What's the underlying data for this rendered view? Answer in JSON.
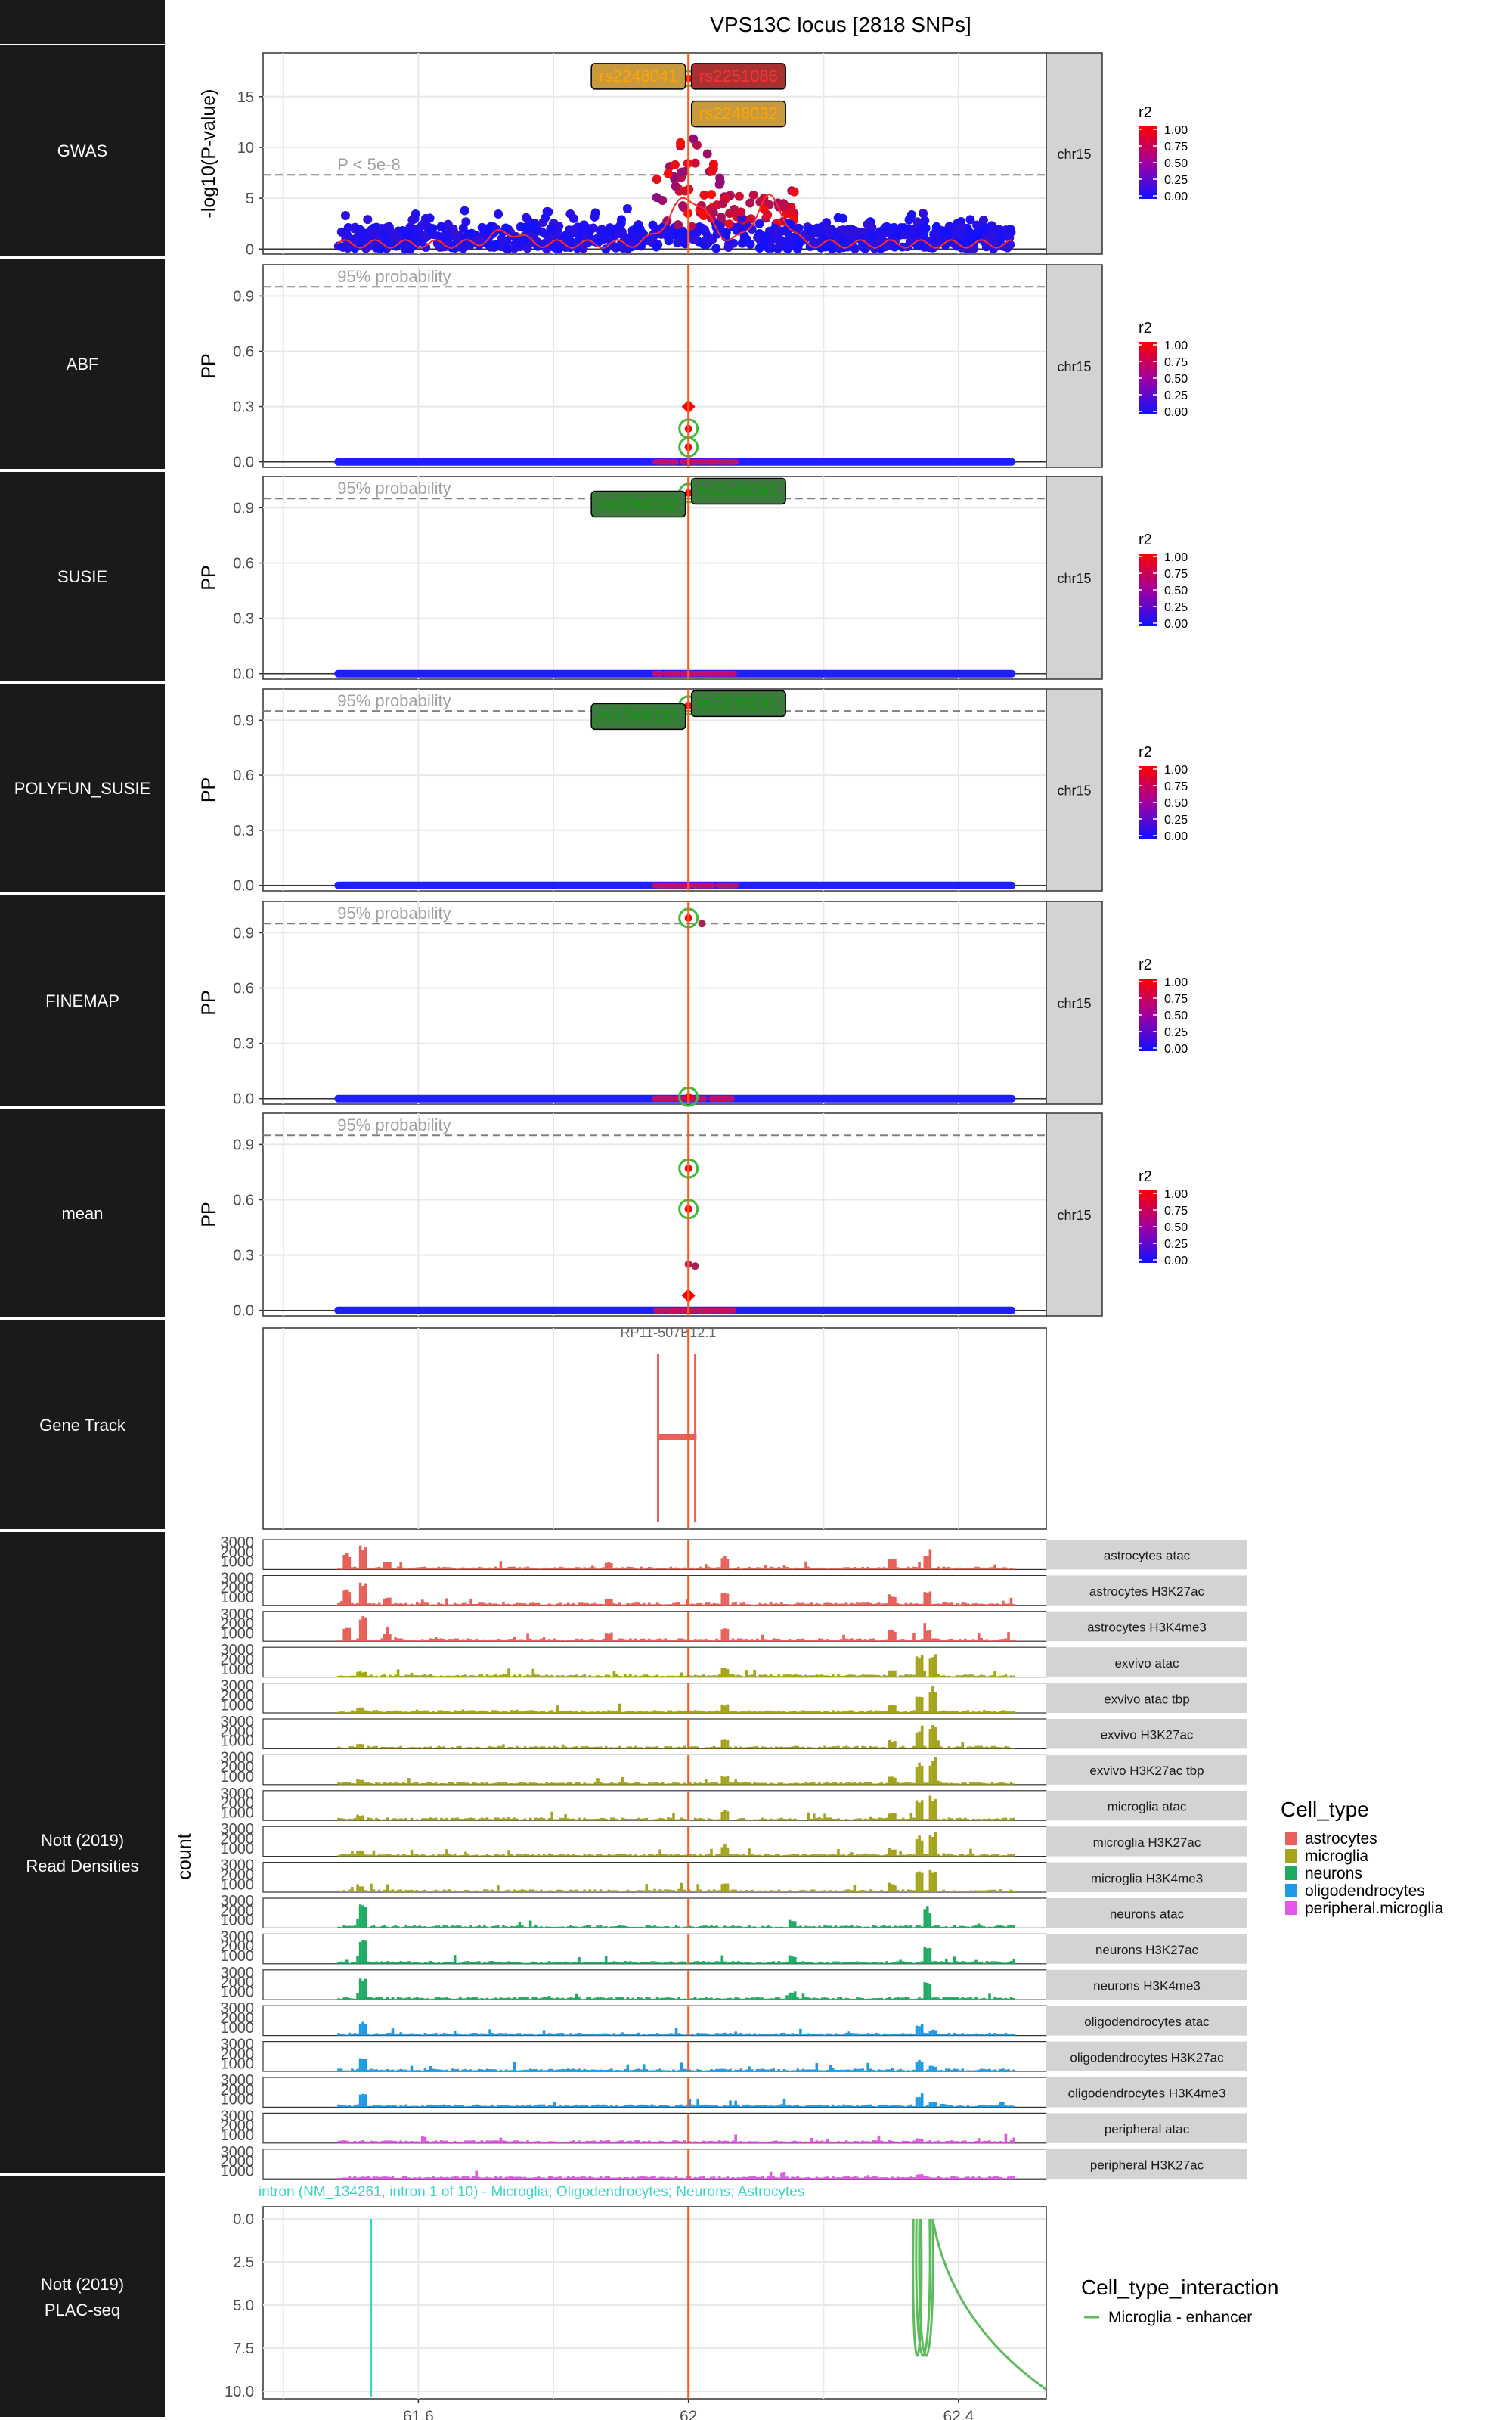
{
  "figure": {
    "title": "VPS13C locus [2818 SNPs]",
    "lead_line_x": 62.0,
    "x_axis": {
      "ticks": [
        61.6,
        62,
        62.4
      ],
      "tick_labels": [
        "61.6",
        "62",
        "62.4"
      ],
      "range": [
        61.37,
        62.53
      ]
    },
    "colors": {
      "lead_line": "#ff5a1f",
      "snp_low": "#1010ff",
      "snp_high": "#ff0000",
      "lead_ring": "#3dbb3d",
      "strip_bg": "#d3d3d3",
      "left_strip_bg": "#1a1a1a",
      "gwas_curve": "#ff2a2a",
      "threshold_line": "#808080"
    }
  },
  "row_labels": [
    "GWAS",
    "ABF",
    "SUSIE",
    "POLYFUN_SUSIE",
    "FINEMAP",
    "mean",
    "Gene Track",
    "Nott (2019)\nRead Densities",
    "Nott (2019)\nPLAC-seq"
  ],
  "facet_strip": "chr15",
  "color_legend": {
    "title": "r2",
    "labels": [
      "1.00",
      "0.75",
      "0.50",
      "0.25",
      "0.00"
    ]
  },
  "gwas": {
    "ylabel": "-log10(P-value)",
    "yticks": [
      0,
      5,
      10,
      15
    ],
    "ylim": [
      -0.5,
      19.3
    ],
    "threshold": 7.3,
    "threshold_label": "P < 5e-8",
    "snp_labels": [
      {
        "text": "rs2248041",
        "x": 62.0,
        "y": 17.0,
        "side": "left",
        "fill": "#c89a40",
        "color": "#ffa500"
      },
      {
        "text": "rs2251086",
        "x": 62.0,
        "y": 17.0,
        "side": "right",
        "fill": "#a83232",
        "color": "#ff3030"
      },
      {
        "text": "rs2248032",
        "x": 62.0,
        "y": 13.3,
        "side": "right",
        "fill": "#c89a40",
        "color": "#ffa500"
      }
    ]
  },
  "pp_panels": [
    {
      "name": "ABF",
      "ylabel": "PP",
      "threshold_label": "95% probability",
      "labels": []
    },
    {
      "name": "SUSIE",
      "ylabel": "PP",
      "threshold_label": "95% probability",
      "labels": [
        {
          "text": "rs2248041",
          "y": 0.99,
          "side": "right"
        },
        {
          "text": "rs2248032",
          "y": 0.92,
          "side": "left"
        }
      ]
    },
    {
      "name": "POLYFUN_SUSIE",
      "ylabel": "PP",
      "threshold_label": "95% probability",
      "labels": [
        {
          "text": "rs2248041",
          "y": 0.99,
          "side": "right"
        },
        {
          "text": "rs2248032",
          "y": 0.92,
          "side": "left"
        }
      ]
    },
    {
      "name": "FINEMAP",
      "ylabel": "PP",
      "threshold_label": "95% probability",
      "labels": []
    },
    {
      "name": "mean",
      "ylabel": "PP",
      "threshold_label": "95% probability",
      "labels": []
    }
  ],
  "pp_axis": {
    "yticks": [
      0.0,
      0.3,
      0.6,
      0.9
    ],
    "ytick_labels": [
      "0.0",
      "0.3",
      "0.6",
      "0.9"
    ],
    "ylim": [
      -0.03,
      1.07
    ],
    "threshold": 0.95
  },
  "gene_track": {
    "gene_label": "RP11-507B12.1"
  },
  "read_densities": {
    "ylabel": "count",
    "yticks": [
      "3000",
      "2000",
      "1000"
    ],
    "tracks": [
      {
        "label": "astrocytes atac",
        "cell": "astrocytes"
      },
      {
        "label": "astrocytes H3K27ac",
        "cell": "astrocytes"
      },
      {
        "label": "astrocytes H3K4me3",
        "cell": "astrocytes"
      },
      {
        "label": "exvivo atac",
        "cell": "microglia"
      },
      {
        "label": "exvivo atac tbp",
        "cell": "microglia"
      },
      {
        "label": "exvivo H3K27ac",
        "cell": "microglia"
      },
      {
        "label": "exvivo H3K27ac tbp",
        "cell": "microglia"
      },
      {
        "label": "microglia atac",
        "cell": "microglia"
      },
      {
        "label": "microglia H3K27ac",
        "cell": "microglia"
      },
      {
        "label": "microglia H3K4me3",
        "cell": "microglia"
      },
      {
        "label": "neurons atac",
        "cell": "neurons"
      },
      {
        "label": "neurons H3K27ac",
        "cell": "neurons"
      },
      {
        "label": "neurons H3K4me3",
        "cell": "neurons"
      },
      {
        "label": "oligodendrocytes atac",
        "cell": "oligodendrocytes"
      },
      {
        "label": "oligodendrocytes H3K27ac",
        "cell": "oligodendrocytes"
      },
      {
        "label": "oligodendrocytes H3K4me3",
        "cell": "oligodendrocytes"
      },
      {
        "label": "peripheral atac",
        "cell": "peripheral.microglia"
      },
      {
        "label": "peripheral H3K27ac",
        "cell": "peripheral.microglia"
      }
    ]
  },
  "cell_type_legend": {
    "title": "Cell_type",
    "items": [
      {
        "label": "astrocytes",
        "color": "#e8605a"
      },
      {
        "label": "microglia",
        "color": "#a3a31c"
      },
      {
        "label": "neurons",
        "color": "#1fab63"
      },
      {
        "label": "oligodendrocytes",
        "color": "#1d9be6"
      },
      {
        "label": "peripheral.microglia",
        "color": "#e257e8"
      }
    ]
  },
  "plac_seq": {
    "annotation": "intron (NM_134261, intron 1 of 10) - Microglia; Oligodendrocytes; Neurons; Astrocytes",
    "annotation_color": "#3dd6c3",
    "yticks": [
      "0.0",
      "2.5",
      "5.0",
      "7.5",
      "10.0"
    ],
    "ylim": [
      0,
      10.5
    ],
    "legend_title": "Cell_type_interaction",
    "legend_item": "Microglia - enhancer",
    "legend_color": "#5dbb5d"
  }
}
